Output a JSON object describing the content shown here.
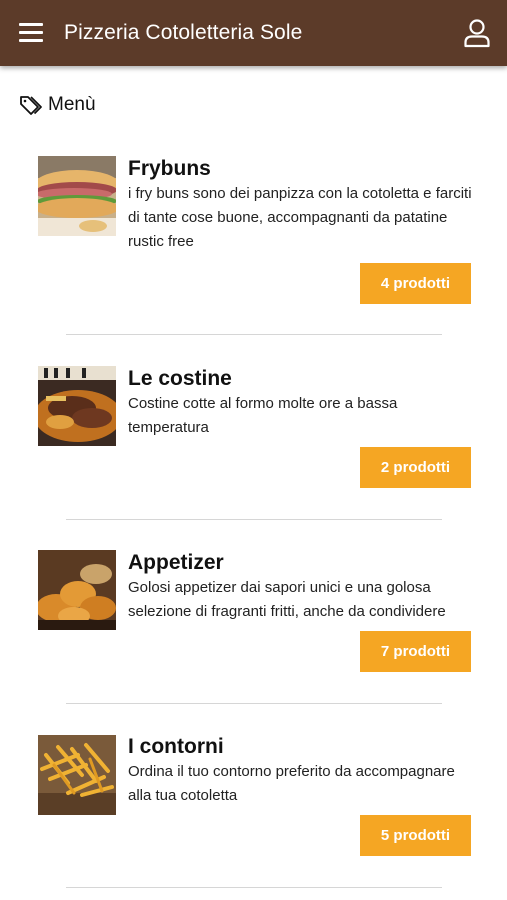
{
  "header": {
    "title": "Pizzeria Cotoletteria Sole",
    "menu_icon": "hamburger-menu-icon",
    "user_icon": "user-account-icon",
    "background": "#5c3b29"
  },
  "section": {
    "icon": "tag-icon",
    "title": "Menù"
  },
  "accent_color": "#f5a623",
  "categories": [
    {
      "title": "Frybuns",
      "description": "i fry buns sono dei panpizza con la cotoletta e farciti di tante cose buone, accompagnanti da patatine rustic free",
      "products_label": "4 prodotti"
    },
    {
      "title": "Le costine",
      "description": "Costine cotte al formo molte ore a bassa temperatura",
      "products_label": "2 prodotti"
    },
    {
      "title": "Appetizer",
      "description": "Golosi appetizer dai sapori unici e una golosa selezione di fragranti fritti, anche da condividere",
      "products_label": "7 prodotti"
    },
    {
      "title": "I contorni",
      "description": "Ordina il tuo contorno preferito da accompagnare alla tua cotoletta",
      "products_label": "5 prodotti"
    }
  ]
}
